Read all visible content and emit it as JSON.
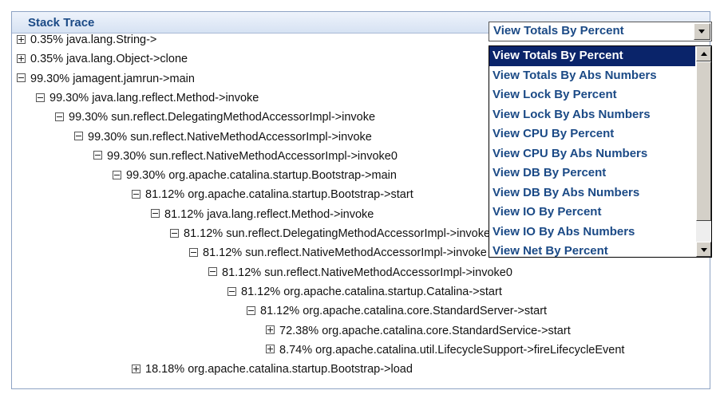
{
  "header": {
    "title": "Stack Trace"
  },
  "view_select": {
    "value": "View Totals By Percent",
    "options": [
      "View Totals By Percent",
      "View Totals By Abs Numbers",
      "View Lock By Percent",
      "View Lock By Abs Numbers",
      "View CPU By Percent",
      "View CPU By Abs Numbers",
      "View DB By Percent",
      "View DB By Abs Numbers",
      "View IO By Percent",
      "View IO By Abs Numbers",
      "View Net By Percent"
    ],
    "selected_index": 0
  },
  "tree": [
    {
      "label": "0.35% java.lang.String->",
      "depth": 0,
      "expanded": false
    },
    {
      "label": "0.35% java.lang.Object->clone",
      "depth": 0,
      "expanded": false
    },
    {
      "label": "99.30% jamagent.jamrun->main",
      "depth": 0,
      "expanded": true
    },
    {
      "label": "99.30% java.lang.reflect.Method->invoke",
      "depth": 1,
      "expanded": true
    },
    {
      "label": "99.30% sun.reflect.DelegatingMethodAccessorImpl->invoke",
      "depth": 2,
      "expanded": true
    },
    {
      "label": "99.30% sun.reflect.NativeMethodAccessorImpl->invoke",
      "depth": 3,
      "expanded": true
    },
    {
      "label": "99.30% sun.reflect.NativeMethodAccessorImpl->invoke0",
      "depth": 4,
      "expanded": true
    },
    {
      "label": "99.30% org.apache.catalina.startup.Bootstrap->main",
      "depth": 5,
      "expanded": true
    },
    {
      "label": "81.12% org.apache.catalina.startup.Bootstrap->start",
      "depth": 6,
      "expanded": true
    },
    {
      "label": "81.12% java.lang.reflect.Method->invoke",
      "depth": 7,
      "expanded": true
    },
    {
      "label": "81.12% sun.reflect.DelegatingMethodAccessorImpl->invoke",
      "depth": 8,
      "expanded": true
    },
    {
      "label": "81.12% sun.reflect.NativeMethodAccessorImpl->invoke",
      "depth": 9,
      "expanded": true
    },
    {
      "label": "81.12% sun.reflect.NativeMethodAccessorImpl->invoke0",
      "depth": 10,
      "expanded": true
    },
    {
      "label": "81.12% org.apache.catalina.startup.Catalina->start",
      "depth": 11,
      "expanded": true
    },
    {
      "label": "81.12% org.apache.catalina.core.StandardServer->start",
      "depth": 12,
      "expanded": true
    },
    {
      "label": "72.38% org.apache.catalina.core.StandardService->start",
      "depth": 13,
      "expanded": false
    },
    {
      "label": "8.74% org.apache.catalina.util.LifecycleSupport->fireLifecycleEvent",
      "depth": 13,
      "expanded": false
    },
    {
      "label": "18.18% org.apache.catalina.startup.Bootstrap->load",
      "depth": 6,
      "expanded": false
    }
  ]
}
